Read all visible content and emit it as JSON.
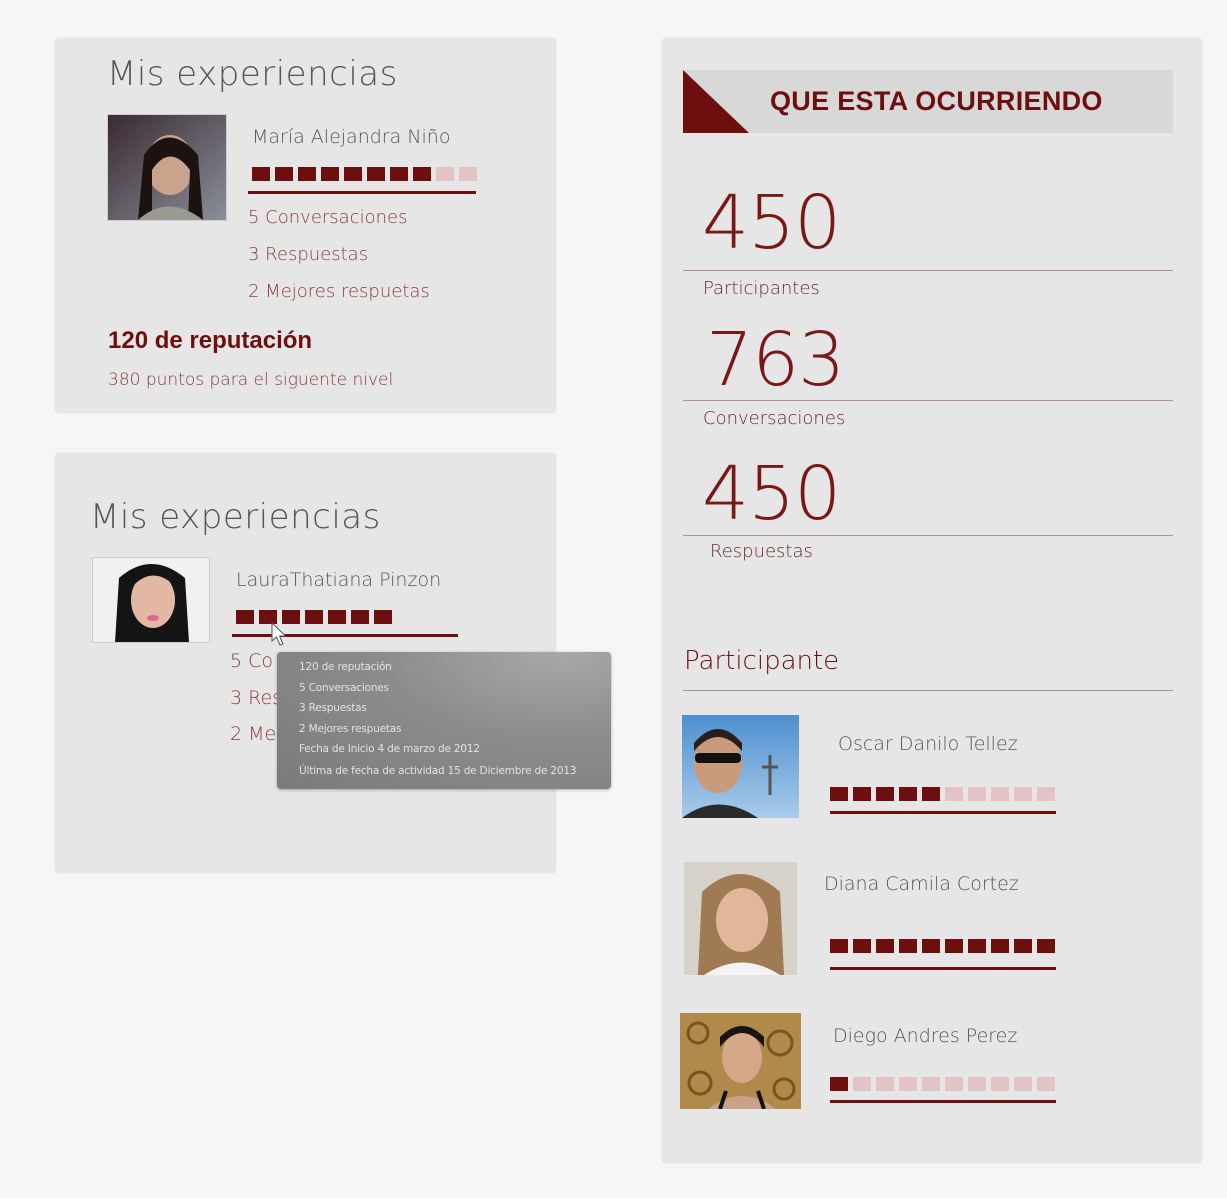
{
  "card1": {
    "title": "Mis experiencias",
    "user_name": "María Alejandra Niño",
    "level": {
      "filled": 8,
      "total": 10
    },
    "stats": [
      "5 Conversaciones",
      "3 Respuestas",
      "2 Mejores respuetas"
    ],
    "reputation": "120 de reputación",
    "next_level": "380 puntos para el siguente nivel"
  },
  "card2": {
    "title": "Mis experiencias",
    "user_name": "LauraThatiana Pinzon",
    "level": {
      "filled": 7,
      "total": 7
    },
    "stats": [
      "5 Co",
      "3 Res",
      "2 Me"
    ],
    "tooltip": [
      "120 de reputación",
      "5 Conversaciones",
      "3 Respuestas",
      "2 Mejores respuetas",
      "Fecha de Inicio 4 de marzo de 2012",
      "Última de fecha de actividad 15 de Diciembre de 2013"
    ]
  },
  "right": {
    "banner": "QUE ESTA OCURRIENDO",
    "metrics": [
      {
        "value": "450",
        "label": "Participantes"
      },
      {
        "value": "763",
        "label": "Conversaciones"
      },
      {
        "value": "450",
        "label": "Respuestas"
      }
    ],
    "section_title": "Participante",
    "participants": [
      {
        "name": "Oscar Danilo Tellez",
        "filled": 5,
        "total": 10
      },
      {
        "name": "Diana Camila Cortez",
        "filled": 10,
        "total": 10
      },
      {
        "name": "Diego Andres Perez",
        "filled": 1,
        "total": 10
      }
    ]
  },
  "colors": {
    "accent": "#6e0f0f",
    "accent_light": "#e3c4c4",
    "card": "#e6e6e6"
  }
}
